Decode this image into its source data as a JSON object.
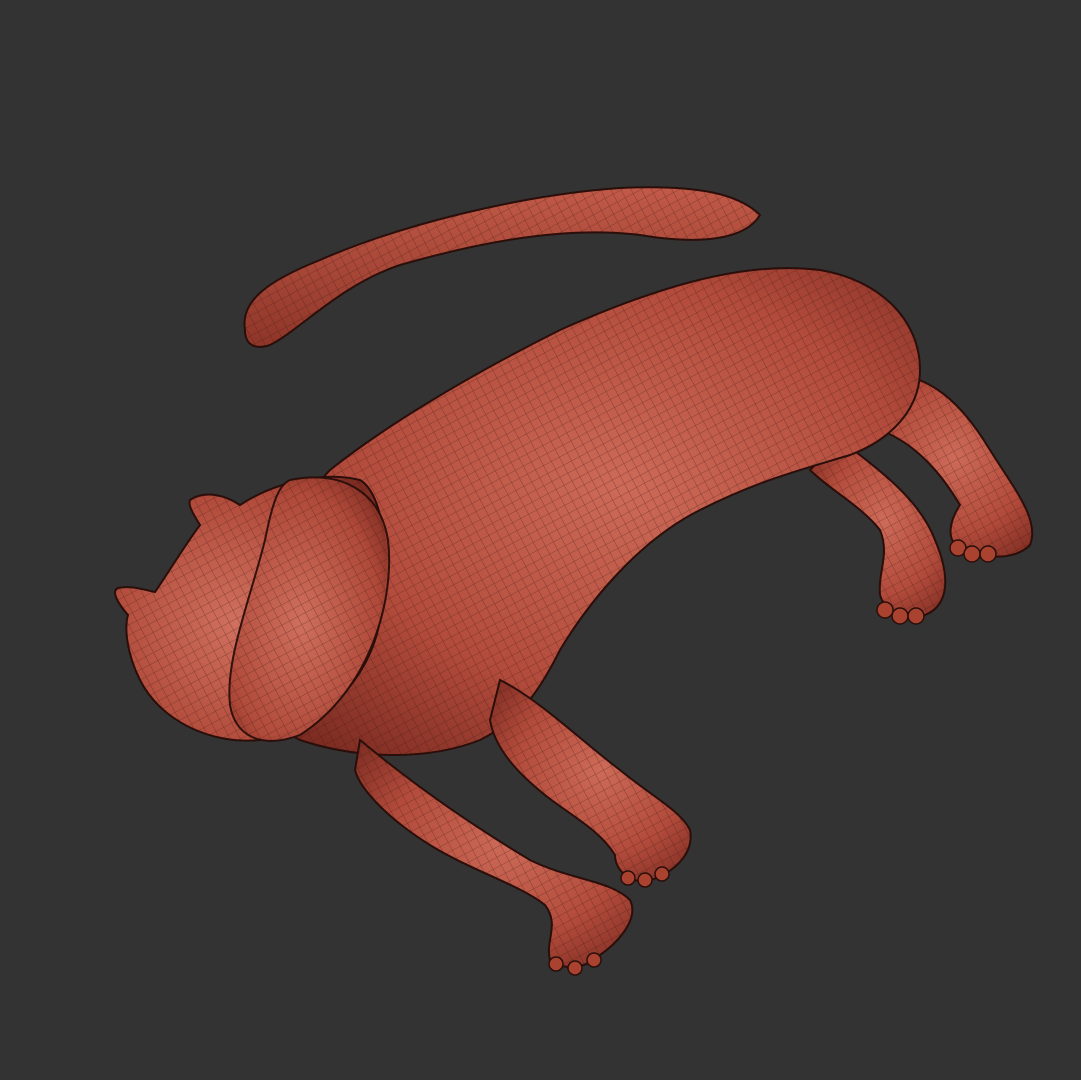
{
  "viewport": {
    "background_color": "#333333",
    "model_color": "#b04a3a",
    "wire_color": "#3a1410",
    "subject": "cat-sculpt-wireframe"
  }
}
